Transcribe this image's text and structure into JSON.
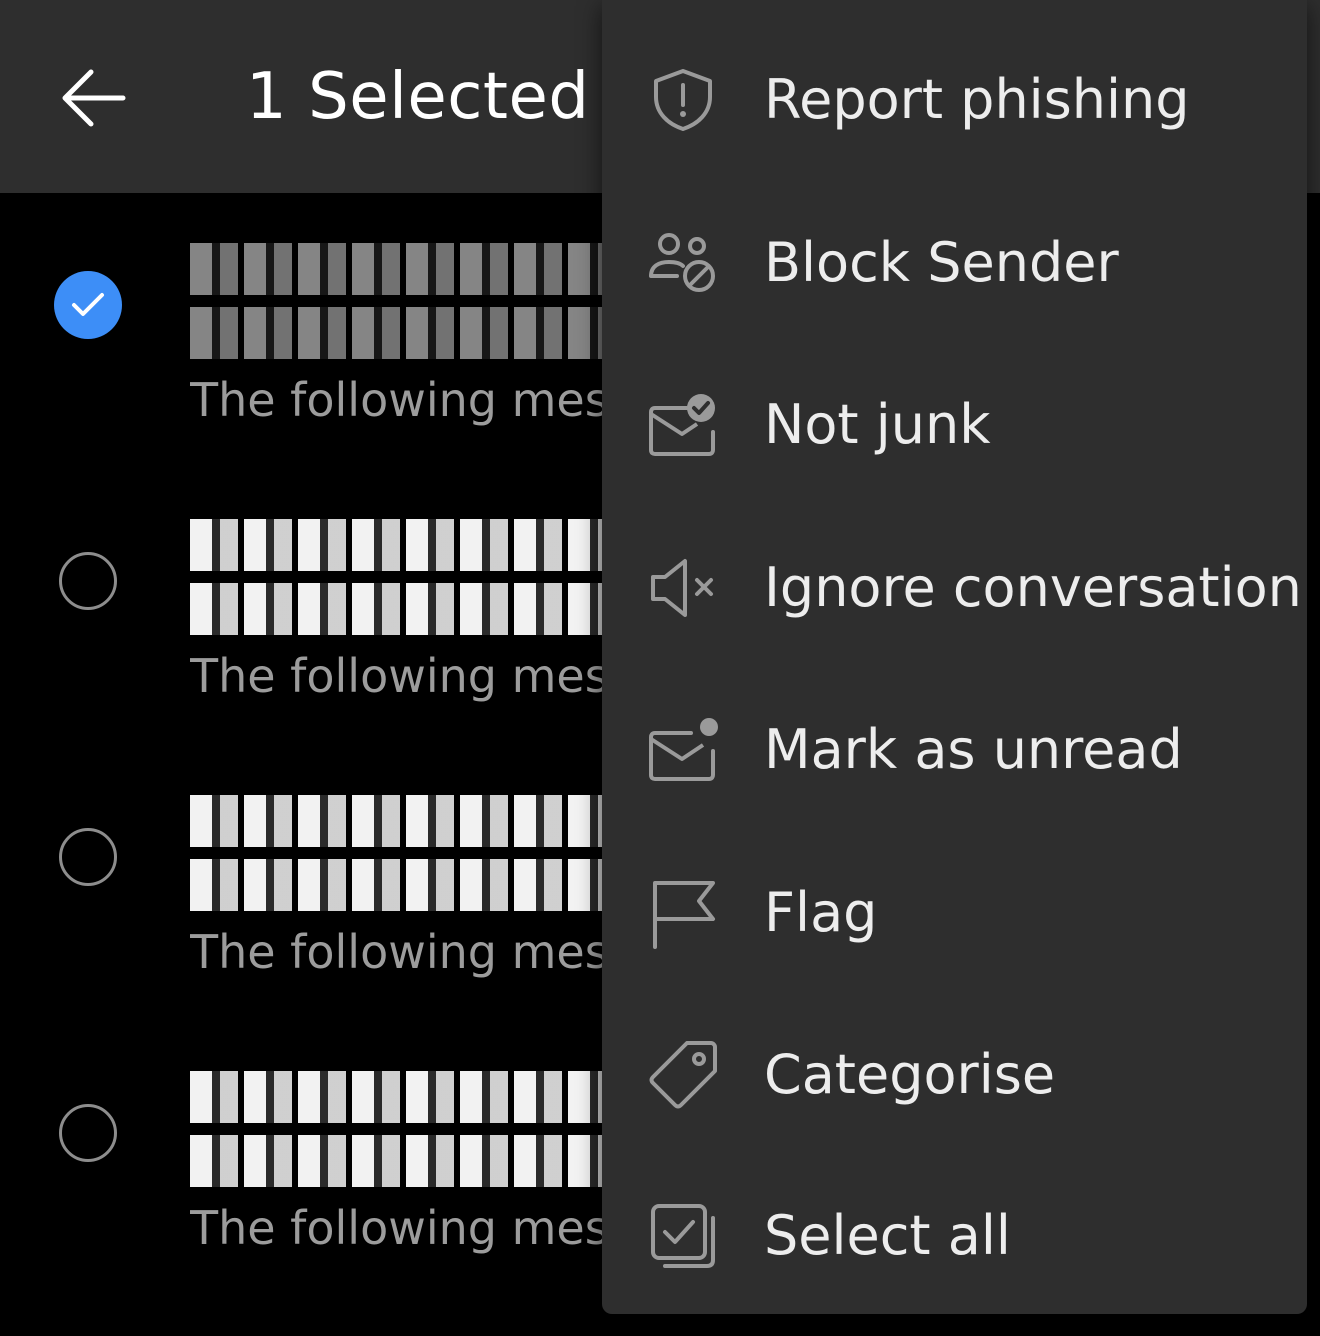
{
  "appbar": {
    "title": "1 Selected",
    "back_icon": "arrow-left-icon"
  },
  "messages": [
    {
      "selected": true,
      "preview": "The following mess"
    },
    {
      "selected": false,
      "preview": "The following mess"
    },
    {
      "selected": false,
      "preview": "The following mess"
    },
    {
      "selected": false,
      "preview": "The following mess"
    }
  ],
  "menu": {
    "items": [
      {
        "label": "Report phishing",
        "icon": "shield-alert-icon"
      },
      {
        "label": "Block Sender",
        "icon": "block-user-icon"
      },
      {
        "label": "Not junk",
        "icon": "mail-check-icon"
      },
      {
        "label": "Ignore conversation",
        "icon": "mute-speaker-icon"
      },
      {
        "label": "Mark as unread",
        "icon": "mail-unread-icon"
      },
      {
        "label": "Flag",
        "icon": "flag-icon"
      },
      {
        "label": "Categorise",
        "icon": "tag-icon"
      },
      {
        "label": "Select all",
        "icon": "select-all-icon"
      }
    ]
  },
  "colors": {
    "accent": "#3d8ef7",
    "surface": "#2e2e2e",
    "background": "#000000",
    "icon": "#9a9a9a"
  }
}
